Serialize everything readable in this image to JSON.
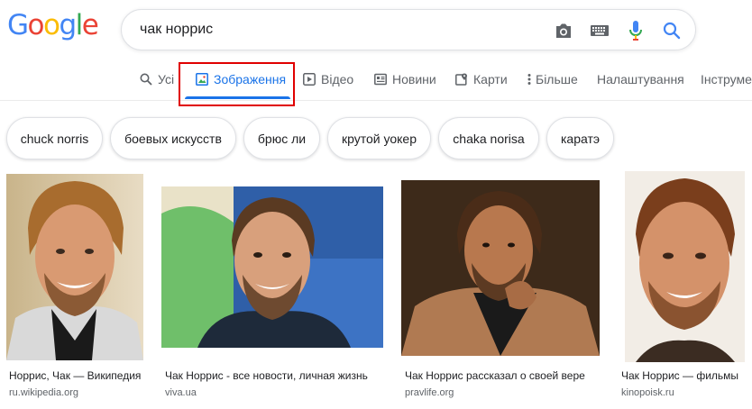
{
  "logo": {
    "text": "Google",
    "letters": [
      "G",
      "o",
      "o",
      "g",
      "l",
      "e"
    ],
    "colors": [
      "#4285F4",
      "#EA4335",
      "#FBBC05",
      "#4285F4",
      "#34A853",
      "#EA4335"
    ]
  },
  "search": {
    "query": "чак норрис"
  },
  "tabs": [
    {
      "label": "Усі",
      "icon": "search-icon"
    },
    {
      "label": "Зображення",
      "icon": "image-icon",
      "active": true
    },
    {
      "label": "Відео",
      "icon": "play-icon"
    },
    {
      "label": "Новини",
      "icon": "news-icon"
    },
    {
      "label": "Карти",
      "icon": "map-icon"
    },
    {
      "label": "Більше",
      "icon": "more-vert-icon"
    },
    {
      "label": "Налаштування"
    },
    {
      "label": "Інструменти"
    }
  ],
  "chips": [
    "chuck norris",
    "боевых искусств",
    "брюс ли",
    "крутой уокер",
    "chaka norisa",
    "каратэ"
  ],
  "results": [
    {
      "title": "Норрис, Чак — Википедия",
      "source": "ru.wikipedia.org"
    },
    {
      "title": "Чак Норрис - все новости, личная жизнь",
      "source": "viva.ua"
    },
    {
      "title": "Чак Норрис рассказал о своей вере",
      "source": "pravlife.org"
    },
    {
      "title": "Чак Норрис — фильмы",
      "source": "kinopoisk.ru"
    }
  ],
  "colors": {
    "accent": "#1a73e8",
    "highlight": "#e00000",
    "muted": "#5f6368"
  }
}
